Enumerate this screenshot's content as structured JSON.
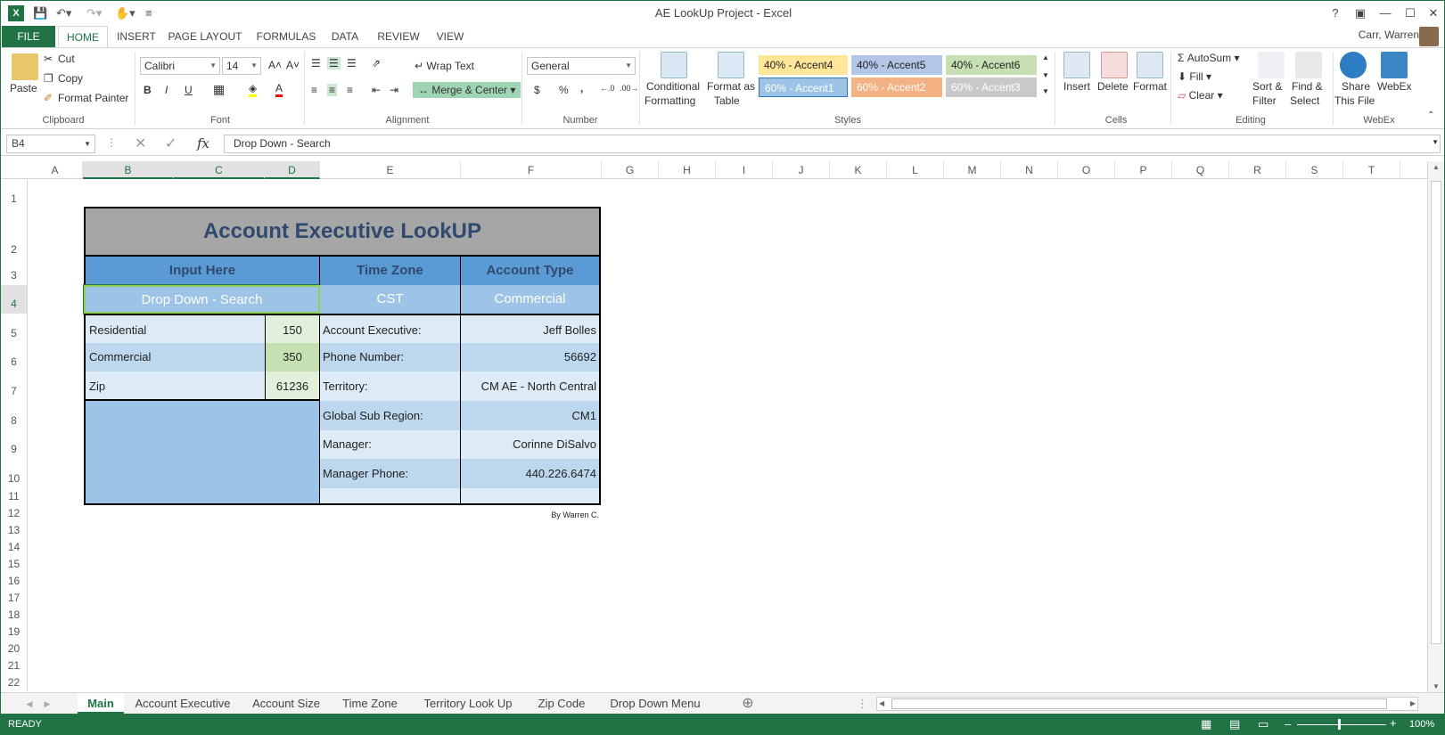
{
  "window": {
    "title": "AE LookUp Project - Excel",
    "help": "?"
  },
  "tabs": [
    "FILE",
    "HOME",
    "INSERT",
    "PAGE LAYOUT",
    "FORMULAS",
    "DATA",
    "REVIEW",
    "VIEW"
  ],
  "user": "Carr, Warren",
  "ribbon": {
    "clipboard": {
      "paste": "Paste",
      "cut": "Cut",
      "copy": "Copy",
      "format_painter": "Format Painter",
      "label": "Clipboard"
    },
    "font": {
      "name": "Calibri",
      "size": "14",
      "bold": "B",
      "italic": "I",
      "underline": "U",
      "label": "Font"
    },
    "alignment": {
      "wrap_text": "Wrap Text",
      "merge_center": "Merge & Center",
      "label": "Alignment"
    },
    "number": {
      "format": "General",
      "currency": "$",
      "percent": "%",
      "comma": ",",
      "label": "Number"
    },
    "styles": {
      "conditional": "Conditional",
      "conditional2": "Formatting",
      "format_table": "Format as",
      "format_table2": "Table",
      "items": [
        "40% - Accent4",
        "40% - Accent5",
        "40% - Accent6",
        "60% - Accent1",
        "60% - Accent2",
        "60% - Accent3"
      ],
      "label": "Styles"
    },
    "cells": {
      "insert": "Insert",
      "delete": "Delete",
      "format": "Format",
      "label": "Cells"
    },
    "editing": {
      "autosum": "AutoSum",
      "fill": "Fill",
      "clear": "Clear",
      "sort": "Sort &",
      "sort2": "Filter",
      "find": "Find &",
      "find2": "Select",
      "label": "Editing"
    },
    "webex": {
      "share": "Share",
      "share2": "This File",
      "webex": "WebEx",
      "label": "WebEx"
    }
  },
  "formula_bar": {
    "name_box": "B4",
    "fx": "fx",
    "value": "Drop Down - Search"
  },
  "columns": [
    "A",
    "B",
    "C",
    "D",
    "E",
    "F",
    "G",
    "H",
    "I",
    "J",
    "K",
    "L",
    "M",
    "N",
    "O",
    "P",
    "Q",
    "R",
    "S",
    "T"
  ],
  "rows": [
    "1",
    "2",
    "3",
    "4",
    "5",
    "6",
    "7",
    "8",
    "9",
    "10",
    "11",
    "12",
    "13",
    "14",
    "15",
    "16",
    "17",
    "18",
    "19",
    "20",
    "21",
    "22"
  ],
  "sheet": {
    "title": "Account Executive LookUP",
    "input_header": "Input Here",
    "tz_header": "Time Zone",
    "type_header": "Account Type",
    "input_value": "Drop Down - Search",
    "tz_value": "CST",
    "type_value": "Commercial",
    "left_rows": [
      {
        "label": "Residential",
        "value": "150"
      },
      {
        "label": "Commercial",
        "value": "350"
      },
      {
        "label": "Zip",
        "value": "61236"
      }
    ],
    "right_rows": [
      {
        "label": "Account Executive:",
        "value": "Jeff Bolles"
      },
      {
        "label": "Phone Number:",
        "value": "56692"
      },
      {
        "label": "Territory:",
        "value": "CM AE - North Central"
      },
      {
        "label": "Global Sub Region:",
        "value": "CM1"
      },
      {
        "label": "Manager:",
        "value": "Corinne DiSalvo"
      },
      {
        "label": "Manager Phone:",
        "value": "440.226.6474"
      }
    ],
    "credit": "By Warren C."
  },
  "sheet_tabs": [
    "Main",
    "Account Executive",
    "Account Size",
    "Time Zone",
    "Territory Look Up",
    "Zip Code",
    "Drop Down Menu"
  ],
  "status": {
    "ready": "READY",
    "zoom": "100%"
  },
  "colors": {
    "excel_green": "#217346",
    "header_blue": "#5b9bd5",
    "light_blue": "#9dc3e6",
    "row_light": "#ddebf7",
    "row_mid": "#bdd7ee",
    "green_cell": "#c6e0b4",
    "title_gray": "#a6a6a6"
  }
}
